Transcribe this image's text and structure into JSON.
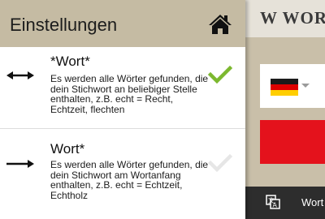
{
  "settings_panel": {
    "title": "Einstellungen",
    "home_icon": "home-icon",
    "options": [
      {
        "title": "*Wort*",
        "description": "Es werden alle Wörter gefunden, die dein Stichwort an beliebiger Stelle enthalten, z.B. echt = Recht, Echtzeit, flechten",
        "icon": "double-arrow-icon",
        "selected": true
      },
      {
        "title": "Wort*",
        "description": "Es werden alle Wörter gefunden, die dein Stichwort am Wortanfang enthalten, z.B. echt = Echtzeit, Echtholz",
        "icon": "right-arrow-icon",
        "selected": false
      }
    ]
  },
  "background_app": {
    "logo_text": "W WOR",
    "language_flag": "germany-flag-icon",
    "bottom_bar_label": "Wort",
    "bottom_bar_icon": "translate-icon"
  },
  "colors": {
    "header_bg": "#c5bba3",
    "check_active": "#7cb82f",
    "check_inactive": "#e6e6e6",
    "action_red": "#e4121c",
    "bottom_bar": "#2d2d2d"
  }
}
